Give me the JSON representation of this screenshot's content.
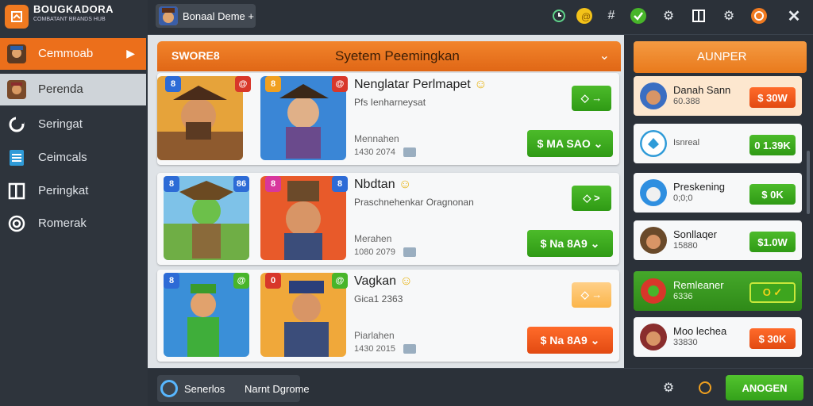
{
  "app": {
    "title_line1": "BOUGKADORA",
    "title_line2": "COMBATANT BRANDS HUB"
  },
  "sidebar": {
    "items": [
      {
        "label": "Cemmoab",
        "icon": "game-avatar-icon"
      },
      {
        "label": "Perenda",
        "icon": "character-avatar-icon"
      },
      {
        "label": "Seringat",
        "icon": "refresh-icon"
      },
      {
        "label": "Ceimcals",
        "icon": "list-document-icon"
      },
      {
        "label": "Peringkat",
        "icon": "panel-icon"
      },
      {
        "label": "Romerak",
        "icon": "target-icon"
      }
    ]
  },
  "topbar": {
    "chip_label": "Bonaal Deme +",
    "icons": [
      "clock-icon",
      "coin-icon",
      "hashtag-icon",
      "check-icon",
      "settings-icon",
      "panel-icon",
      "gear-icon",
      "crown-icon",
      "close-icon"
    ]
  },
  "header": {
    "left_label": "SWORE8",
    "title": "Syetem Peemingkan"
  },
  "cards": [
    {
      "title": "Nenglatar Perlmapet",
      "sub": "Pfs Ienharneysat",
      "meta1": "Mennahen",
      "meta2": "1430 2074",
      "b1": "8",
      "b2": "@",
      "b3": "8",
      "b4": "@",
      "btn_small": "◇ →",
      "btn_large": "$ MA SAO",
      "large_color": "green",
      "small_color": "green"
    },
    {
      "title": "Nbdtan",
      "sub": "Praschnehenkar Oragnonan",
      "meta1": "Merahen",
      "meta2": "1080 2079",
      "b1": "8",
      "b2": "86",
      "b3": "8",
      "b4": "8",
      "btn_small": "◇ >",
      "btn_large": "$ Na 8A9",
      "large_color": "green",
      "small_color": "green"
    },
    {
      "title": "Vagkan",
      "sub": "Gica1 2363",
      "meta1": "Piarlahen",
      "meta2": "1430 2015",
      "b1": "8",
      "b2": "@",
      "b3": "0",
      "b4": "@",
      "btn_small": "◇ →",
      "btn_large": "$ Na 8A9",
      "large_color": "orange",
      "small_color": "peach"
    }
  ],
  "right_panel": {
    "head": "AUNPER",
    "rows": [
      {
        "name": "Danah Sann",
        "sub": "60.388",
        "btn": "$ 30W",
        "color": "orange"
      },
      {
        "name": "",
        "sub": "Isnreal",
        "btn": "0 1.39K",
        "color": "green"
      },
      {
        "name": "Preskening",
        "sub": "0;0;0",
        "btn": "$ 0K",
        "color": "green"
      },
      {
        "name": "Sonllaqer",
        "sub": "15880",
        "btn": "$1.0W",
        "color": "green"
      },
      {
        "name": "Remleaner",
        "sub": "6336",
        "btn": "O ✓",
        "color": "green"
      },
      {
        "name": "Moo lechea",
        "sub": "33830",
        "btn": "$ 30K",
        "color": "orange"
      }
    ]
  },
  "bottombar": {
    "left_label": "Senerlos",
    "mid_label": "Narnt Dgrome",
    "btn": "ANOGEN"
  }
}
